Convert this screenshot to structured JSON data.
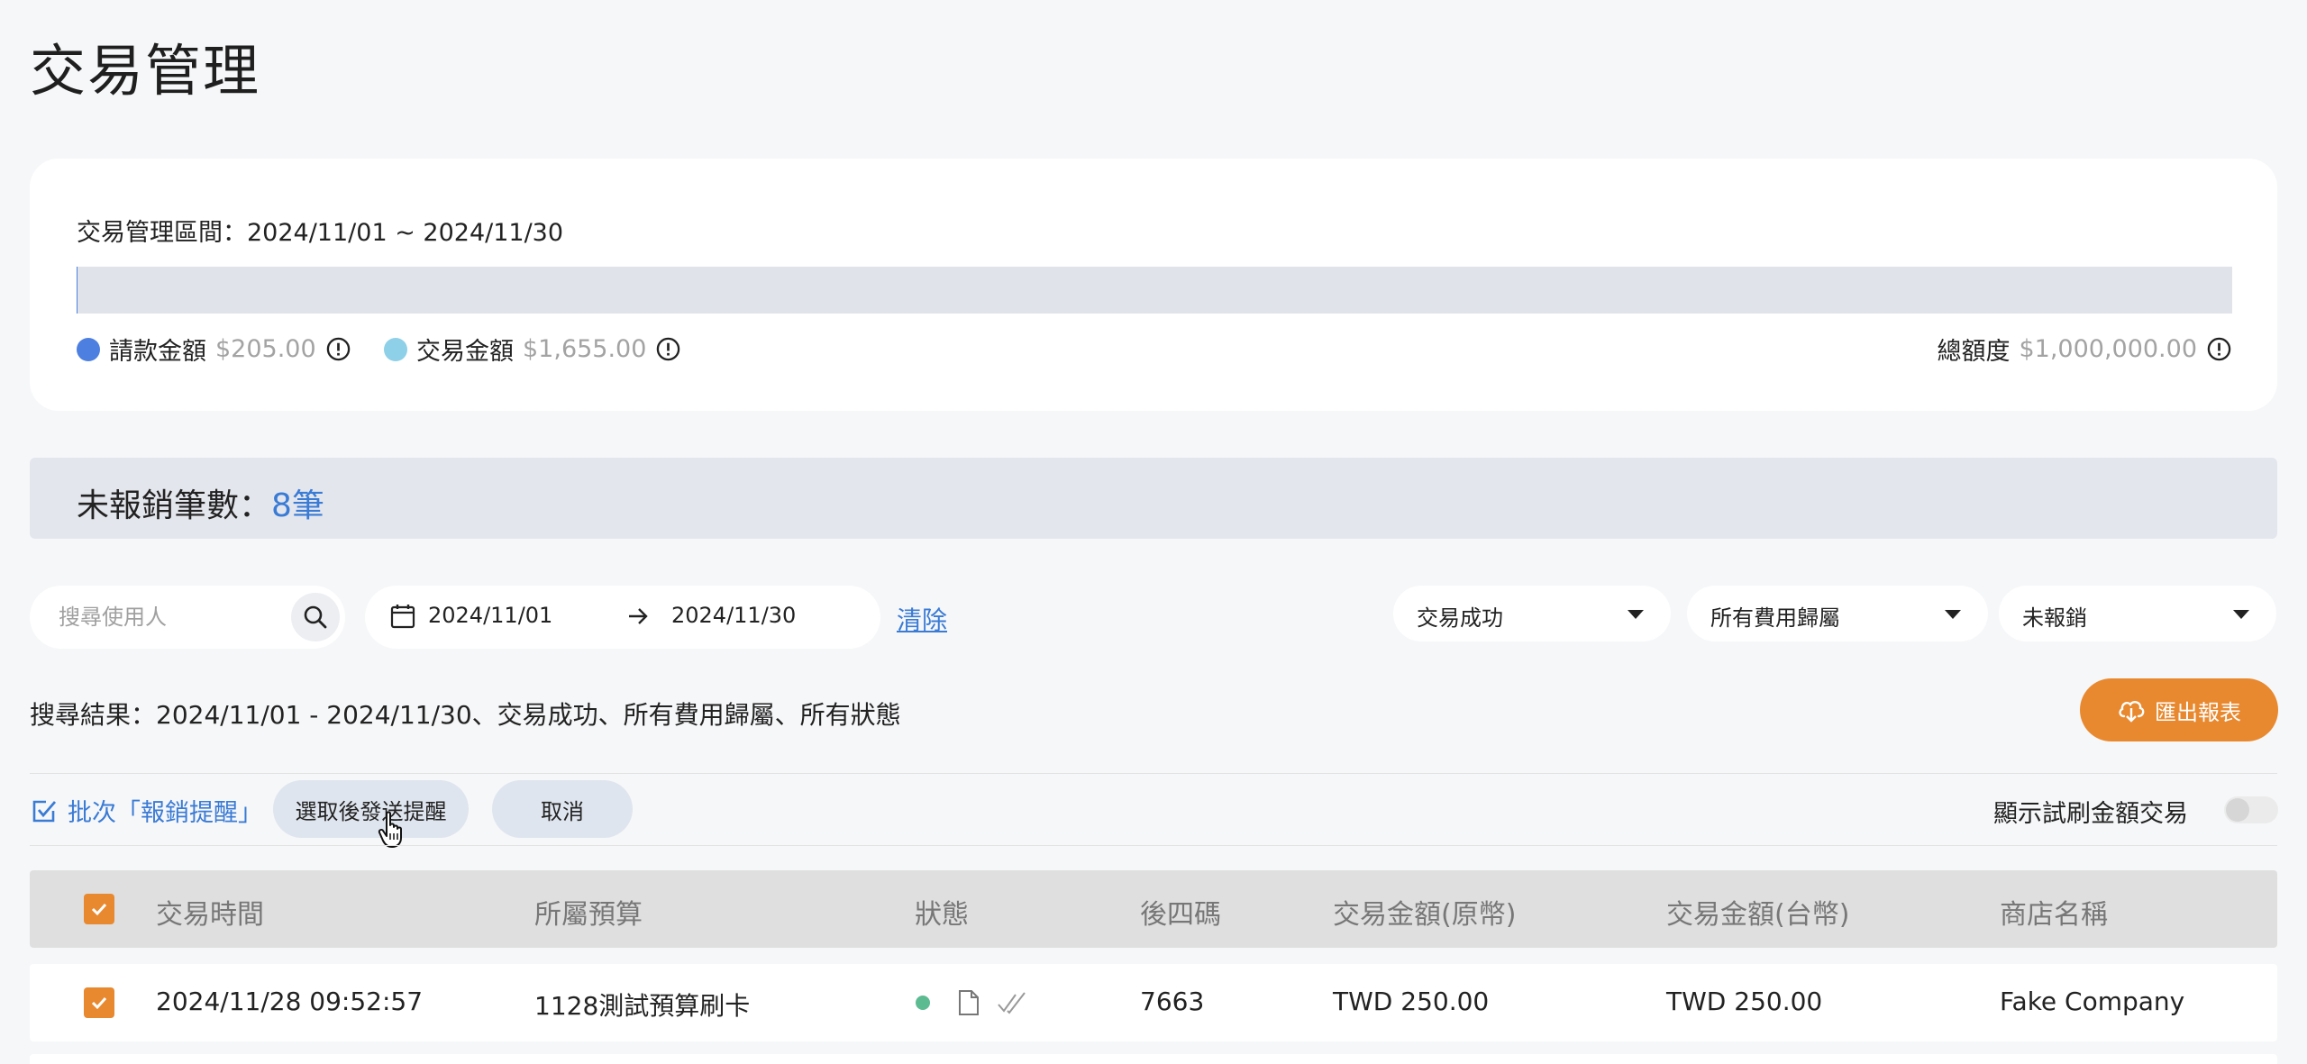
{
  "page": {
    "title": "交易管理"
  },
  "summary": {
    "period_label": "交易管理區間：2024/11/01 ~ 2024/11/30",
    "progress_fraction": 0.000205,
    "requested": {
      "label": "請款金額",
      "amount": "$205.00",
      "color": "#4d7fe0",
      "icon": "info-icon"
    },
    "transaction": {
      "label": "交易金額",
      "amount": "$1,655.00",
      "color": "#8dd0e8",
      "icon": "info-icon"
    },
    "total": {
      "label": "總額度",
      "amount": "$1,000,000.00",
      "icon": "info-icon"
    }
  },
  "pending": {
    "label": "未報銷筆數：",
    "count": "8筆"
  },
  "filters": {
    "search_placeholder": "搜尋使用人",
    "search_value": "",
    "date_start": "2024/11/01",
    "date_end": "2024/11/30",
    "clear_label": "清除",
    "status_selected": "交易成功",
    "category_selected": "所有費用歸屬",
    "reimbursement_selected": "未報銷"
  },
  "results": {
    "text": "搜尋結果：2024/11/01 - 2024/11/30、交易成功、所有費用歸屬、所有狀態",
    "export_label": "匯出報表"
  },
  "batch": {
    "label": "批次「報銷提醒」",
    "send_label": "選取後發送提醒",
    "cancel_label": "取消",
    "toggle_label": "顯示試刷金額交易",
    "toggle_on": false
  },
  "table": {
    "header_checked": true,
    "columns": [
      "交易時間",
      "所屬預算",
      "狀態",
      "後四碼",
      "交易金額(原幣)",
      "交易金額(台幣)",
      "商店名稱"
    ],
    "rows": [
      {
        "checked": true,
        "time": "2024/11/28 09:52:57",
        "budget": "1128測試預算刷卡",
        "status_color": "#5cbb91",
        "last4": "7663",
        "amount_original": "TWD 250.00",
        "amount_twd": "TWD 250.00",
        "merchant": "Fake Company"
      }
    ]
  },
  "colors": {
    "accent_blue": "#3a7bd5",
    "accent_orange": "#e9892f",
    "status_green": "#5cbb91"
  }
}
